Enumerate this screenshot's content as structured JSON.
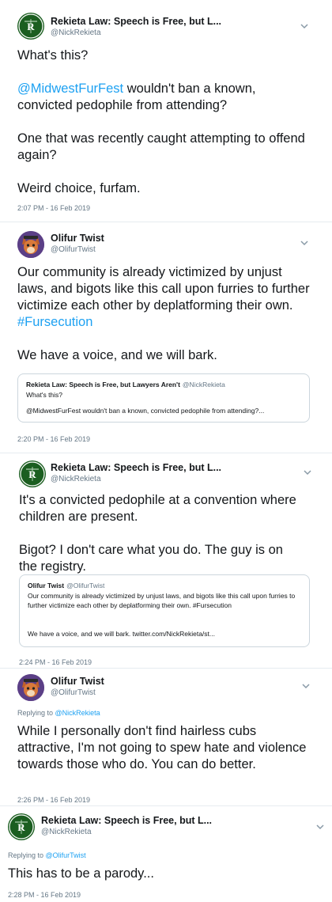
{
  "tweets": [
    {
      "name": "Rekieta Law: Speech is Free, but L...",
      "handle": "@NickRekieta",
      "mention": "@MidwestFurFest",
      "line1": "What's this?",
      "line2_rest": " wouldn't ban a known, convicted pedophile from attending?",
      "line3": "One that was recently caught attempting to offend again?",
      "line4": "Weird choice, furfam.",
      "time": "2:07 PM - 16 Feb 2019"
    },
    {
      "name": "Olifur Twist",
      "handle": "@OlifurTwist",
      "para1": "Our community is already victimized by unjust laws, and bigots like this call upon furries to further victimize each other by deplatforming their own. ",
      "hashtag": "#Fursecution",
      "para2": "We have a voice, and we will bark.",
      "quote": {
        "name": "Rekieta Law: Speech is Free, but Lawyers Aren't",
        "handle": "@NickRekieta",
        "line1": "What's this?",
        "line2": "@MidwestFurFest wouldn't ban a known, convicted pedophile from attending?..."
      },
      "time": "2:20 PM - 16 Feb 2019"
    },
    {
      "name": "Rekieta Law: Speech is Free, but L...",
      "handle": "@NickRekieta",
      "para1": "It's a convicted pedophile at a convention where children are present.",
      "para2": "Bigot?  I don't care what you do.  The guy is on the registry.",
      "quote": {
        "name": "Olifur Twist",
        "handle": "@OlifurTwist",
        "text1": "Our community is already victimized by unjust laws, and bigots like this call upon furries to further victimize each other by deplatforming their own. #Fursecution",
        "text2": "We have a voice, and we will bark. twitter.com/NickRekieta/st..."
      },
      "time": "2:24 PM - 16 Feb 2019"
    },
    {
      "name": "Olifur Twist",
      "handle": "@OlifurTwist",
      "replying_prefix": "Replying to ",
      "replying_to": "@NickRekieta",
      "text": "While I personally don't find hairless cubs attractive, I'm not going to spew hate and violence towards those who do. You can do better.",
      "time": "2:26 PM - 16 Feb 2019"
    },
    {
      "name": "Rekieta Law: Speech is Free, but L...",
      "handle": "@NickRekieta",
      "replying_prefix": "Replying to ",
      "replying_to": "@OlifurTwist",
      "text": "This has to be a parody...",
      "time": "2:28 PM - 16 Feb 2019"
    }
  ],
  "colors": {
    "link": "#1da1f2",
    "muted": "#657786",
    "border": "#ccd6dd"
  },
  "icons": {
    "menu": "chevron-down-icon",
    "rekieta_avatar": "scales-of-justice-logo",
    "olifur_avatar": "fox-character-avatar"
  }
}
